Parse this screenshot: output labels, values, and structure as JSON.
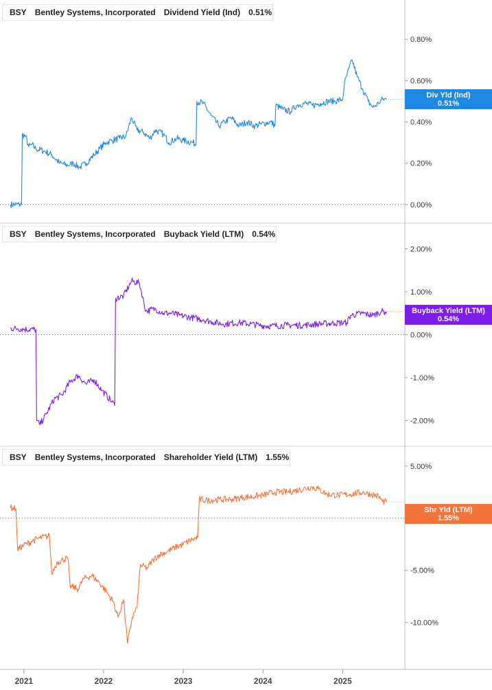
{
  "chart_data": [
    {
      "type": "line",
      "ticker": "BSY",
      "company": "Bentley Systems, Incorporated",
      "metric": "Dividend Yield (Ind)",
      "current_value": "0.51%",
      "tag_label": "Div Yld (Ind)",
      "color": "#1e88e5",
      "ylim": [
        -0.09,
        0.99
      ],
      "yticks": [
        0,
        0.2,
        0.4,
        0.6,
        0.8
      ],
      "ytick_labels": [
        "0.00%",
        "0.20%",
        "0.40%",
        "0.60%",
        "0.80%"
      ],
      "points": [
        [
          2020.83,
          0
        ],
        [
          2020.97,
          0
        ],
        [
          2020.98,
          0.34
        ],
        [
          2021.02,
          0.33
        ],
        [
          2021.06,
          0.28
        ],
        [
          2021.1,
          0.29
        ],
        [
          2021.15,
          0.27
        ],
        [
          2021.25,
          0.26
        ],
        [
          2021.35,
          0.24
        ],
        [
          2021.45,
          0.2
        ],
        [
          2021.55,
          0.19
        ],
        [
          2021.62,
          0.2
        ],
        [
          2021.7,
          0.18
        ],
        [
          2021.78,
          0.2
        ],
        [
          2021.88,
          0.24
        ],
        [
          2021.95,
          0.27
        ],
        [
          2022.03,
          0.3
        ],
        [
          2022.1,
          0.31
        ],
        [
          2022.2,
          0.32
        ],
        [
          2022.28,
          0.33
        ],
        [
          2022.35,
          0.42
        ],
        [
          2022.42,
          0.36
        ],
        [
          2022.5,
          0.35
        ],
        [
          2022.58,
          0.32
        ],
        [
          2022.65,
          0.36
        ],
        [
          2022.75,
          0.34
        ],
        [
          2022.82,
          0.3
        ],
        [
          2022.92,
          0.32
        ],
        [
          2023.0,
          0.31
        ],
        [
          2023.12,
          0.3
        ],
        [
          2023.16,
          0.29
        ],
        [
          2023.17,
          0.5
        ],
        [
          2023.25,
          0.49
        ],
        [
          2023.35,
          0.43
        ],
        [
          2023.45,
          0.38
        ],
        [
          2023.52,
          0.4
        ],
        [
          2023.6,
          0.42
        ],
        [
          2023.7,
          0.38
        ],
        [
          2023.8,
          0.4
        ],
        [
          2023.9,
          0.38
        ],
        [
          2023.98,
          0.39
        ],
        [
          2024.1,
          0.4
        ],
        [
          2024.15,
          0.38
        ],
        [
          2024.16,
          0.48
        ],
        [
          2024.25,
          0.46
        ],
        [
          2024.35,
          0.45
        ],
        [
          2024.42,
          0.48
        ],
        [
          2024.52,
          0.49
        ],
        [
          2024.62,
          0.48
        ],
        [
          2024.72,
          0.49
        ],
        [
          2024.82,
          0.5
        ],
        [
          2024.9,
          0.5
        ],
        [
          2025.0,
          0.51
        ],
        [
          2025.02,
          0.58
        ],
        [
          2025.08,
          0.66
        ],
        [
          2025.12,
          0.7
        ],
        [
          2025.18,
          0.62
        ],
        [
          2025.25,
          0.56
        ],
        [
          2025.32,
          0.5
        ],
        [
          2025.38,
          0.47
        ],
        [
          2025.45,
          0.49
        ],
        [
          2025.5,
          0.51
        ],
        [
          2025.55,
          0.51
        ]
      ],
      "last_x": 2025.55
    },
    {
      "type": "line",
      "ticker": "BSY",
      "company": "Bentley Systems, Incorporated",
      "metric": "Buyback Yield (LTM)",
      "current_value": "0.54%",
      "tag_label": "Buyback Yield (LTM)",
      "color": "#7b1fe8",
      "ylim": [
        -2.6,
        2.6
      ],
      "yticks": [
        -2,
        -1,
        0,
        1,
        2
      ],
      "ytick_labels": [
        "-2.00%",
        "-1.00%",
        "0.00%",
        "1.00%",
        "2.00%"
      ],
      "points": [
        [
          2020.83,
          0.15
        ],
        [
          2020.92,
          0.14
        ],
        [
          2021.0,
          0.13
        ],
        [
          2021.15,
          0.12
        ],
        [
          2021.16,
          -2.0
        ],
        [
          2021.2,
          -2.1
        ],
        [
          2021.28,
          -1.85
        ],
        [
          2021.38,
          -1.5
        ],
        [
          2021.48,
          -1.4
        ],
        [
          2021.58,
          -1.1
        ],
        [
          2021.68,
          -0.95
        ],
        [
          2021.78,
          -1.15
        ],
        [
          2021.88,
          -1.05
        ],
        [
          2021.98,
          -1.3
        ],
        [
          2022.1,
          -1.55
        ],
        [
          2022.14,
          -1.65
        ],
        [
          2022.15,
          0.85
        ],
        [
          2022.25,
          0.9
        ],
        [
          2022.35,
          1.25
        ],
        [
          2022.45,
          1.2
        ],
        [
          2022.53,
          0.55
        ],
        [
          2022.65,
          0.6
        ],
        [
          2022.75,
          0.5
        ],
        [
          2022.85,
          0.5
        ],
        [
          2022.95,
          0.45
        ],
        [
          2023.1,
          0.4
        ],
        [
          2023.25,
          0.35
        ],
        [
          2023.36,
          0.3
        ],
        [
          2023.5,
          0.25
        ],
        [
          2023.7,
          0.28
        ],
        [
          2023.85,
          0.25
        ],
        [
          2023.95,
          0.22
        ],
        [
          2024.1,
          0.2
        ],
        [
          2024.3,
          0.22
        ],
        [
          2024.5,
          0.22
        ],
        [
          2024.7,
          0.25
        ],
        [
          2024.9,
          0.27
        ],
        [
          2025.05,
          0.28
        ],
        [
          2025.1,
          0.45
        ],
        [
          2025.25,
          0.5
        ],
        [
          2025.38,
          0.45
        ],
        [
          2025.48,
          0.54
        ],
        [
          2025.55,
          0.54
        ]
      ],
      "last_x": 2025.55
    },
    {
      "type": "line",
      "ticker": "BSY",
      "company": "Bentley Systems, Incorporated",
      "metric": "Shareholder Yield (LTM)",
      "current_value": "1.55%",
      "tag_label": "Shr Yld (LTM)",
      "color": "#f4743b",
      "ylim": [
        -14.5,
        6.9
      ],
      "yticks": [
        -10,
        -5,
        0,
        5
      ],
      "ytick_labels": [
        "-10.00%",
        "-5.00%",
        "0.00%",
        "5.00%"
      ],
      "points": [
        [
          2020.83,
          1
        ],
        [
          2020.9,
          0.9
        ],
        [
          2020.92,
          -3.0
        ],
        [
          2021.0,
          -2.6
        ],
        [
          2021.1,
          -2.2
        ],
        [
          2021.2,
          -1.9
        ],
        [
          2021.32,
          -1.7
        ],
        [
          2021.35,
          -5.3
        ],
        [
          2021.42,
          -4.2
        ],
        [
          2021.55,
          -3.8
        ],
        [
          2021.58,
          -6.5
        ],
        [
          2021.68,
          -6.8
        ],
        [
          2021.75,
          -5.8
        ],
        [
          2021.85,
          -5.5
        ],
        [
          2021.95,
          -6.2
        ],
        [
          2022.05,
          -7.2
        ],
        [
          2022.12,
          -8.0
        ],
        [
          2022.18,
          -9.5
        ],
        [
          2022.25,
          -7.8
        ],
        [
          2022.3,
          -12.0
        ],
        [
          2022.36,
          -9.5
        ],
        [
          2022.42,
          -8.5
        ],
        [
          2022.46,
          -4.5
        ],
        [
          2022.55,
          -4.8
        ],
        [
          2022.62,
          -4.0
        ],
        [
          2022.7,
          -3.5
        ],
        [
          2022.8,
          -3.2
        ],
        [
          2022.9,
          -2.8
        ],
        [
          2023.0,
          -2.5
        ],
        [
          2023.12,
          -2.0
        ],
        [
          2023.18,
          -1.9
        ],
        [
          2023.2,
          1.8
        ],
        [
          2023.3,
          1.7
        ],
        [
          2023.45,
          1.8
        ],
        [
          2023.6,
          1.8
        ],
        [
          2023.75,
          2.0
        ],
        [
          2023.9,
          2.1
        ],
        [
          2024.0,
          2.2
        ],
        [
          2024.15,
          2.5
        ],
        [
          2024.3,
          2.5
        ],
        [
          2024.45,
          2.7
        ],
        [
          2024.6,
          3.0
        ],
        [
          2024.7,
          2.8
        ],
        [
          2024.8,
          2.3
        ],
        [
          2024.95,
          2.2
        ],
        [
          2025.1,
          2.3
        ],
        [
          2025.25,
          2.5
        ],
        [
          2025.35,
          2.3
        ],
        [
          2025.45,
          2.1
        ],
        [
          2025.5,
          1.6
        ],
        [
          2025.55,
          1.55
        ]
      ],
      "last_x": 2025.55
    }
  ],
  "x_axis": {
    "ticks": [
      2021,
      2022,
      2023,
      2024,
      2025
    ],
    "labels": [
      "2021",
      "2022",
      "2023",
      "2024",
      "2025"
    ],
    "xlim": [
      2020.7,
      2025.78
    ]
  }
}
